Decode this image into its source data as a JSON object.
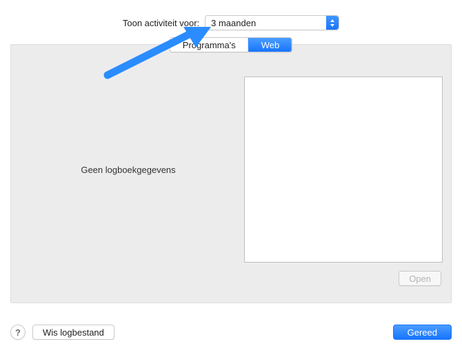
{
  "topRow": {
    "label": "Toon activiteit voor:",
    "selected": "3 maanden"
  },
  "tabs": {
    "programs": "Programma's",
    "web": "Web"
  },
  "panel": {
    "emptyMessage": "Geen logboekgegevens",
    "openLabel": "Open"
  },
  "bottom": {
    "help": "?",
    "clearLog": "Wis logbestand",
    "done": "Gereed"
  }
}
